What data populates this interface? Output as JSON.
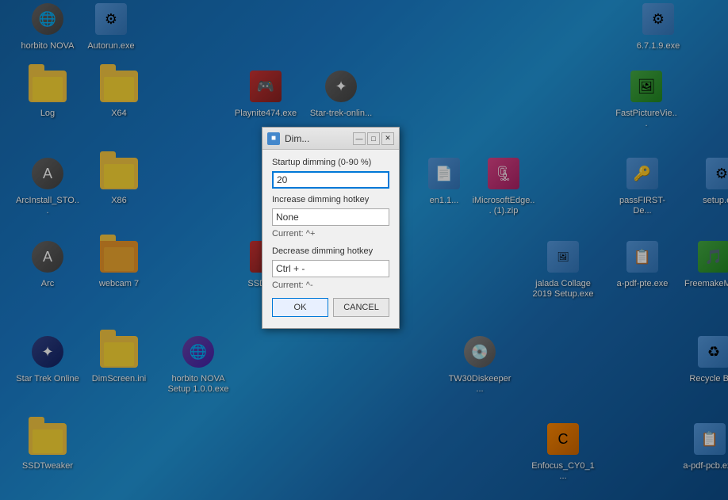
{
  "desktop": {
    "icons": [
      {
        "id": "horbito-nova",
        "label": "horbito NOVA",
        "pos": "icon-horbito",
        "type": "circle"
      },
      {
        "id": "autorun",
        "label": "Autorun.exe",
        "pos": "icon-autorun",
        "type": "exe"
      },
      {
        "id": "671exe",
        "label": "6.7.1.9.exe",
        "pos": "icon-671",
        "type": "exe"
      },
      {
        "id": "log",
        "label": "Log",
        "pos": "icon-log",
        "type": "folder"
      },
      {
        "id": "x64",
        "label": "X64",
        "pos": "icon-x64",
        "type": "folder"
      },
      {
        "id": "playnite",
        "label": "Playnite474.exe",
        "pos": "icon-playnite",
        "type": "red"
      },
      {
        "id": "startrek-online-exe",
        "label": "Star-trek-onlin...",
        "pos": "icon-startrek-online",
        "type": "circle"
      },
      {
        "id": "fastpicture",
        "label": "FastPictureVie...",
        "pos": "icon-fastpicture",
        "type": "green"
      },
      {
        "id": "arcinstall",
        "label": "ArcInstall_STO...",
        "pos": "icon-arcinstall",
        "type": "circle"
      },
      {
        "id": "x86",
        "label": "X86",
        "pos": "icon-x86",
        "type": "folder"
      },
      {
        "id": "en11",
        "label": "en1.1...",
        "pos": "icon-en11",
        "type": "exe"
      },
      {
        "id": "microsoftedge",
        "label": "iMicrosoftEdge... (1).zip",
        "pos": "icon-microsoftedge",
        "type": "multi"
      },
      {
        "id": "passfirst",
        "label": "passFIRST-De...",
        "pos": "icon-passfirst",
        "type": "exe"
      },
      {
        "id": "setup",
        "label": "setup.exe",
        "pos": "icon-setup",
        "type": "exe"
      },
      {
        "id": "arc",
        "label": "Arc",
        "pos": "icon-arc",
        "type": "circle"
      },
      {
        "id": "webcam7",
        "label": "webcam 7",
        "pos": "icon-webcam7",
        "type": "folder"
      },
      {
        "id": "ssdtw",
        "label": "SSDTw...",
        "pos": "icon-ssdtw",
        "type": "red"
      },
      {
        "id": "jalada",
        "label": "jalada Collage 2019 Setup.exe",
        "pos": "icon-jalada",
        "type": "exe"
      },
      {
        "id": "apdf",
        "label": "a-pdf-pte.exe",
        "pos": "icon-apdf",
        "type": "exe"
      },
      {
        "id": "freemake",
        "label": "FreemakeMu...",
        "pos": "icon-freemake",
        "type": "green"
      },
      {
        "id": "star-trek-online",
        "label": "Star Trek Online",
        "pos": "icon-startrekonline",
        "type": "circle"
      },
      {
        "id": "dimscreen",
        "label": "DimScreen.ini",
        "pos": "icon-dimscreen",
        "type": "folder"
      },
      {
        "id": "horbito-setup",
        "label": "horbito NOVA Setup 1.0.0.exe",
        "pos": "icon-horbito2",
        "type": "circle"
      },
      {
        "id": "tw30",
        "label": "TW30Diskeeper...",
        "pos": "icon-tw30",
        "type": "circle"
      },
      {
        "id": "recycle",
        "label": "Recycle Bi...",
        "pos": "icon-recycle",
        "type": "exe"
      },
      {
        "id": "ssdtweaker",
        "label": "SSDTweaker",
        "pos": "icon-ssdtweaker",
        "type": "folder"
      },
      {
        "id": "enfocus",
        "label": "Enfocus_CY0_1...",
        "pos": "icon-enfocus",
        "type": "orange"
      },
      {
        "id": "apdfpcb",
        "label": "a-pdf-pcb.exe",
        "pos": "icon-apdfpcb",
        "type": "exe"
      }
    ]
  },
  "dialog": {
    "title": "Dim...",
    "title_icon": "■",
    "startup_label": "Startup dimming (0-90 %)",
    "startup_value": "20",
    "increase_label": "Increase dimming hotkey",
    "increase_value": "None",
    "increase_current": "Current: ^+",
    "decrease_label": "Decrease dimming hotkey",
    "decrease_value": "Ctrl + -",
    "decrease_current": "Current: ^-",
    "ok_label": "OK",
    "cancel_label": "CANCEL",
    "minimize_label": "—",
    "maximize_label": "□",
    "close_label": "✕"
  }
}
